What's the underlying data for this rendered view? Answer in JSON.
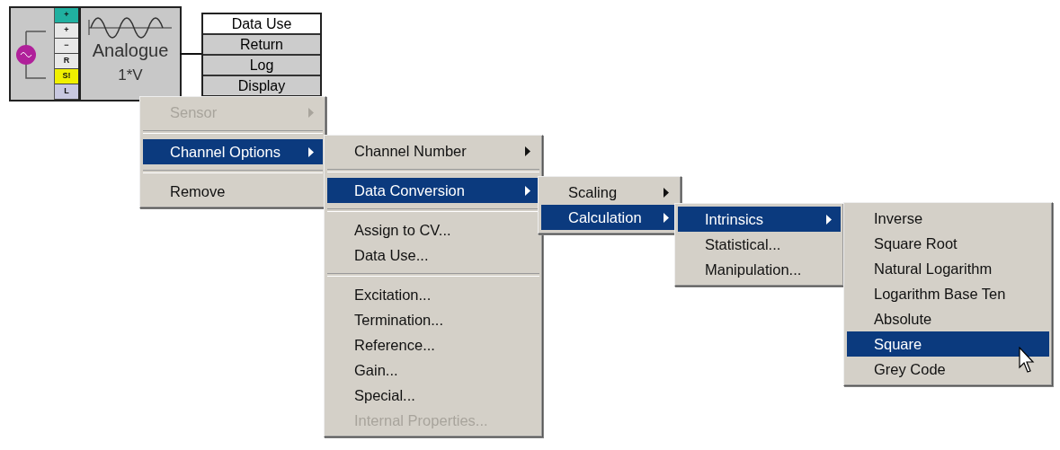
{
  "sensor_block": {
    "pins": [
      {
        "label": "+",
        "color": "#20b0a0"
      },
      {
        "label": "+",
        "color": "#e8e8e8"
      },
      {
        "label": "−",
        "color": "#e8e8e8"
      },
      {
        "label": "R",
        "color": "#e8e8e8"
      },
      {
        "label": "S!",
        "color": "#f0f000"
      },
      {
        "label": "L",
        "color": "#c8c8e0"
      }
    ],
    "title": "Analogue",
    "unit": "1*V"
  },
  "data_use": {
    "header": "Data Use",
    "rows": [
      "Return",
      "Log",
      "Display"
    ]
  },
  "menus": [
    {
      "items": [
        {
          "kind": "item",
          "label": "Sensor",
          "selected": false,
          "disabled": true,
          "submenu": true
        },
        {
          "kind": "separator"
        },
        {
          "kind": "item",
          "label": "Channel Options",
          "selected": true,
          "disabled": false,
          "submenu": true
        },
        {
          "kind": "separator"
        },
        {
          "kind": "item",
          "label": "Remove",
          "selected": false,
          "disabled": false,
          "submenu": false
        }
      ]
    },
    {
      "items": [
        {
          "kind": "item",
          "label": "Channel Number",
          "selected": false,
          "disabled": false,
          "submenu": true
        },
        {
          "kind": "separator"
        },
        {
          "kind": "item",
          "label": "Data Conversion",
          "selected": true,
          "disabled": false,
          "submenu": true
        },
        {
          "kind": "separator"
        },
        {
          "kind": "item",
          "label": "Assign to CV...",
          "selected": false,
          "disabled": false,
          "submenu": false
        },
        {
          "kind": "item",
          "label": "Data Use...",
          "selected": false,
          "disabled": false,
          "submenu": false
        },
        {
          "kind": "separator"
        },
        {
          "kind": "item",
          "label": "Excitation...",
          "selected": false,
          "disabled": false,
          "submenu": false
        },
        {
          "kind": "item",
          "label": "Termination...",
          "selected": false,
          "disabled": false,
          "submenu": false
        },
        {
          "kind": "item",
          "label": "Reference...",
          "selected": false,
          "disabled": false,
          "submenu": false
        },
        {
          "kind": "item",
          "label": "Gain...",
          "selected": false,
          "disabled": false,
          "submenu": false
        },
        {
          "kind": "item",
          "label": "Special...",
          "selected": false,
          "disabled": false,
          "submenu": false
        },
        {
          "kind": "item",
          "label": "Internal Properties...",
          "selected": false,
          "disabled": true,
          "submenu": false
        }
      ]
    },
    {
      "items": [
        {
          "kind": "item",
          "label": "Scaling",
          "selected": false,
          "disabled": false,
          "submenu": true
        },
        {
          "kind": "item",
          "label": "Calculation",
          "selected": true,
          "disabled": false,
          "submenu": true
        }
      ]
    },
    {
      "items": [
        {
          "kind": "item",
          "label": "Intrinsics",
          "selected": true,
          "disabled": false,
          "submenu": true
        },
        {
          "kind": "item",
          "label": "Statistical...",
          "selected": false,
          "disabled": false,
          "submenu": false
        },
        {
          "kind": "item",
          "label": "Manipulation...",
          "selected": false,
          "disabled": false,
          "submenu": false
        }
      ]
    },
    {
      "items": [
        {
          "kind": "item",
          "label": "Inverse",
          "selected": false,
          "disabled": false,
          "submenu": false
        },
        {
          "kind": "item",
          "label": "Square Root",
          "selected": false,
          "disabled": false,
          "submenu": false
        },
        {
          "kind": "item",
          "label": "Natural Logarithm",
          "selected": false,
          "disabled": false,
          "submenu": false
        },
        {
          "kind": "item",
          "label": "Logarithm Base Ten",
          "selected": false,
          "disabled": false,
          "submenu": false
        },
        {
          "kind": "item",
          "label": "Absolute",
          "selected": false,
          "disabled": false,
          "submenu": false
        },
        {
          "kind": "item",
          "label": "Square",
          "selected": true,
          "disabled": false,
          "submenu": false
        },
        {
          "kind": "item",
          "label": "Grey Code",
          "selected": false,
          "disabled": false,
          "submenu": false
        }
      ]
    }
  ]
}
